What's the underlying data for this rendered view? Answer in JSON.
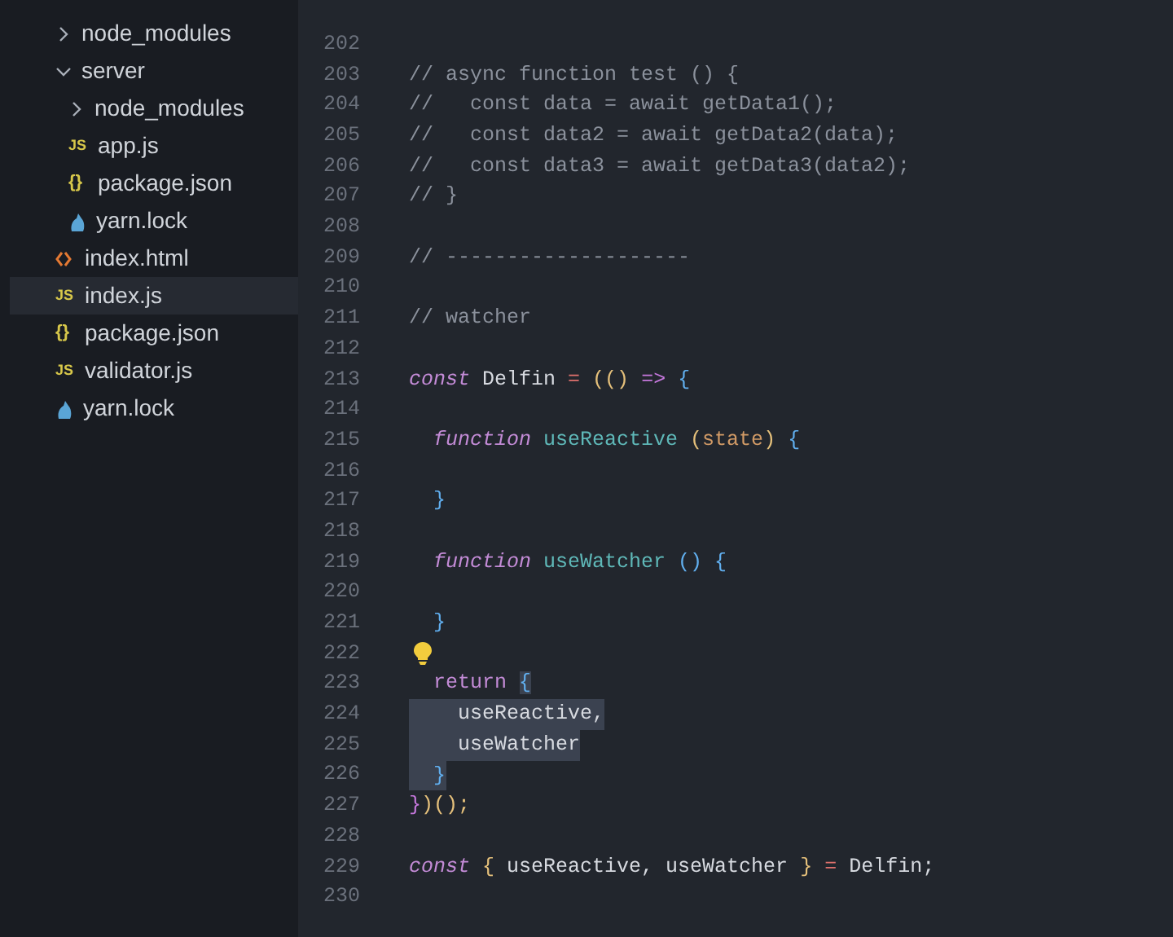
{
  "sidebar": {
    "items": [
      {
        "label": "node_modules",
        "kind": "folder",
        "expanded": false,
        "selected": false
      },
      {
        "label": "server",
        "kind": "folder",
        "expanded": true,
        "selected": false,
        "children": [
          {
            "label": "node_modules",
            "kind": "folder",
            "expanded": false,
            "selected": false
          },
          {
            "label": "app.js",
            "kind": "js",
            "icon_text": "JS",
            "selected": false
          },
          {
            "label": "package.json",
            "kind": "json",
            "icon_text": "{}",
            "selected": false
          },
          {
            "label": "yarn.lock",
            "kind": "lock",
            "selected": false
          }
        ]
      },
      {
        "label": "index.html",
        "kind": "html",
        "selected": false
      },
      {
        "label": "index.js",
        "kind": "js",
        "icon_text": "JS",
        "selected": true
      },
      {
        "label": "package.json",
        "kind": "json",
        "icon_text": "{}",
        "selected": false
      },
      {
        "label": "validator.js",
        "kind": "js",
        "icon_text": "JS",
        "selected": false
      },
      {
        "label": "yarn.lock",
        "kind": "lock",
        "selected": false
      }
    ]
  },
  "editor": {
    "lines": [
      {
        "number": "202",
        "kind": "code",
        "selected": false
      },
      {
        "number": "203",
        "kind": "code",
        "selected": false,
        "tokens": [
          {
            "text": "// async function test () {",
            "kind": "comment"
          }
        ]
      },
      {
        "number": "204",
        "kind": "code",
        "selected": false,
        "tokens": [
          {
            "text": "//   const data = await getData1();",
            "kind": "comment"
          }
        ]
      },
      {
        "number": "205",
        "kind": "code",
        "selected": false,
        "tokens": [
          {
            "text": "//   const data2 = await getData2(data);",
            "kind": "comment"
          }
        ]
      },
      {
        "number": "206",
        "kind": "code",
        "selected": false,
        "tokens": [
          {
            "text": "//   const data3 = await getData3(data2);",
            "kind": "comment"
          }
        ]
      },
      {
        "number": "207",
        "kind": "code",
        "selected": false,
        "tokens": [
          {
            "text": "// }",
            "kind": "comment"
          }
        ]
      },
      {
        "number": "208",
        "kind": "code",
        "selected": false
      },
      {
        "number": "209",
        "kind": "code",
        "selected": false,
        "tokens": [
          {
            "text": "// --------------------",
            "kind": "comment"
          }
        ]
      },
      {
        "number": "210",
        "kind": "code",
        "selected": false
      },
      {
        "number": "211",
        "kind": "code",
        "selected": false,
        "tokens": [
          {
            "text": "// watcher",
            "kind": "comment"
          }
        ]
      },
      {
        "number": "212",
        "kind": "code",
        "selected": false
      },
      {
        "number": "213",
        "kind": "code",
        "selected": false,
        "tokens": [
          {
            "text": "const",
            "kind": "storage"
          },
          {
            "text": " Delfin",
            "kind": "plain"
          },
          {
            "text": " =",
            "kind": "operator"
          },
          {
            "text": " (()",
            "kind": "paren"
          },
          {
            "text": " =>",
            "kind": "arrow"
          },
          {
            "text": " {",
            "kind": "brace"
          }
        ]
      },
      {
        "number": "214",
        "kind": "code",
        "selected": false
      },
      {
        "number": "215",
        "kind": "code",
        "selected": false,
        "tokens": [
          {
            "text": "  function",
            "kind": "storage"
          },
          {
            "text": " useReactive",
            "kind": "func"
          },
          {
            "text": " (",
            "kind": "paren"
          },
          {
            "text": "state",
            "kind": "param"
          },
          {
            "text": ")",
            "kind": "paren"
          },
          {
            "text": " {",
            "kind": "brace"
          }
        ]
      },
      {
        "number": "216",
        "kind": "code",
        "selected": false
      },
      {
        "number": "217",
        "kind": "code",
        "selected": false,
        "tokens": [
          {
            "text": "  }",
            "kind": "brace"
          }
        ]
      },
      {
        "number": "218",
        "kind": "code",
        "selected": false
      },
      {
        "number": "219",
        "kind": "code",
        "selected": false,
        "tokens": [
          {
            "text": "  function",
            "kind": "storage"
          },
          {
            "text": " useWatcher",
            "kind": "func"
          },
          {
            "text": " ()",
            "kind": "brace"
          },
          {
            "text": " {",
            "kind": "brace"
          }
        ]
      },
      {
        "number": "220",
        "kind": "code",
        "selected": false
      },
      {
        "number": "221",
        "kind": "code",
        "selected": false,
        "tokens": [
          {
            "text": "  }",
            "kind": "brace"
          }
        ]
      },
      {
        "number": "222",
        "kind": "hint",
        "selected": false
      },
      {
        "number": "223",
        "kind": "code",
        "selected": false,
        "tokens": [
          {
            "text": "  return ",
            "kind": "keyword"
          },
          {
            "text": "{",
            "kind": "brace-selected"
          }
        ]
      },
      {
        "number": "224",
        "kind": "code",
        "selected": true,
        "tokens": [
          {
            "text": "    useReactive,",
            "kind": "plain"
          }
        ]
      },
      {
        "number": "225",
        "kind": "code",
        "selected": true,
        "tokens": [
          {
            "text": "    useWatcher",
            "kind": "plain"
          }
        ]
      },
      {
        "number": "226",
        "kind": "code",
        "selected": true,
        "tokens": [
          {
            "text": "  }",
            "kind": "brace"
          }
        ]
      },
      {
        "number": "227",
        "kind": "code",
        "selected": false,
        "tokens": [
          {
            "text": "}",
            "kind": "arrow"
          },
          {
            "text": ")();",
            "kind": "paren"
          }
        ]
      },
      {
        "number": "228",
        "kind": "code",
        "selected": false
      },
      {
        "number": "229",
        "kind": "code",
        "selected": false,
        "tokens": [
          {
            "text": "const",
            "kind": "storage"
          },
          {
            "text": " {",
            "kind": "paren"
          },
          {
            "text": " useReactive, useWatcher",
            "kind": "plain"
          },
          {
            "text": " }",
            "kind": "paren"
          },
          {
            "text": " =",
            "kind": "operator"
          },
          {
            "text": " Delfin;",
            "kind": "plain"
          }
        ]
      },
      {
        "number": "230",
        "kind": "code",
        "selected": false
      }
    ]
  }
}
